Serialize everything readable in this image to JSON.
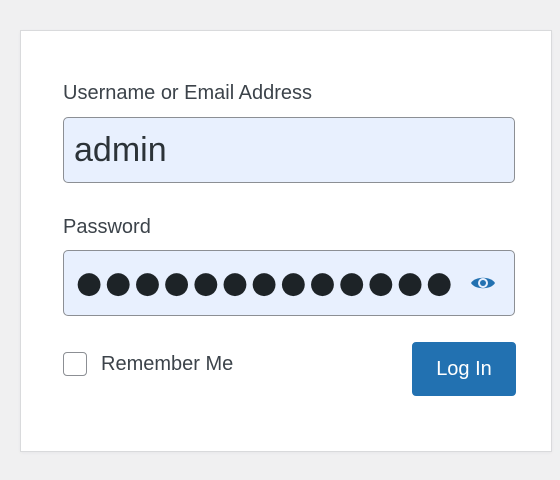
{
  "form": {
    "username_label": "Username or Email Address",
    "username_value": "admin",
    "password_label": "Password",
    "password_masked": "●●●●●●●●●●●●●",
    "password_icon": "eye-icon",
    "remember_label": "Remember Me",
    "remember_checked": false,
    "login_button_label": "Log In"
  },
  "colors": {
    "page_background": "#f0f0f1",
    "card_background": "#ffffff",
    "input_autofill_background": "#e8f0fe",
    "primary_button": "#2271b1",
    "icon": "#2271b1"
  }
}
